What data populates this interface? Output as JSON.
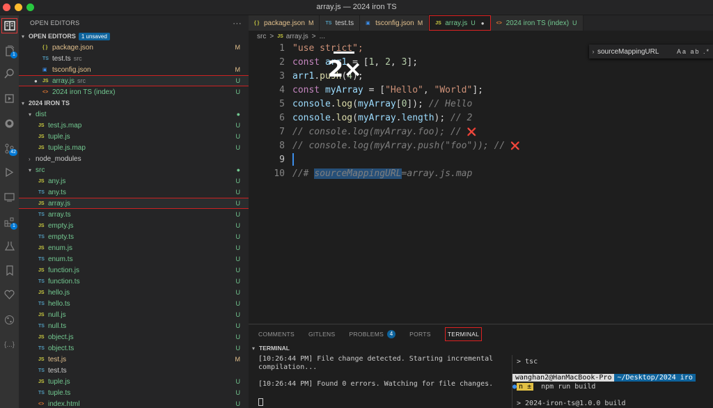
{
  "window": {
    "title": "array.js — 2024 iron TS"
  },
  "activity_bar": {
    "items": [
      {
        "name": "explorer",
        "icon": "explorer-icon",
        "active": true
      },
      {
        "name": "files",
        "icon": "files-icon",
        "badge": "1"
      },
      {
        "name": "search",
        "icon": "search-icon"
      },
      {
        "name": "run",
        "icon": "run-icon"
      },
      {
        "name": "github",
        "icon": "github-icon"
      },
      {
        "name": "source-control",
        "icon": "source-control-icon",
        "badge": "42"
      },
      {
        "name": "debug",
        "icon": "debug-icon"
      },
      {
        "name": "remote",
        "icon": "remote-icon"
      },
      {
        "name": "extensions",
        "icon": "extensions-icon",
        "badge": "1"
      },
      {
        "name": "testing",
        "icon": "flask-icon"
      },
      {
        "name": "bookmarks",
        "icon": "bookmark-icon"
      },
      {
        "name": "favorites",
        "icon": "heart-icon"
      },
      {
        "name": "git-graph",
        "icon": "git-graph-icon"
      },
      {
        "name": "json",
        "icon": "braces-icon"
      }
    ]
  },
  "sidebar": {
    "header": "OPEN EDITORS",
    "open_editors": {
      "title": "OPEN EDITORS",
      "unsaved": "1 unsaved",
      "items": [
        {
          "icon": "{ }",
          "type": "json",
          "name": "package.json",
          "sub": "",
          "status": "M"
        },
        {
          "icon": "TS",
          "type": "ts",
          "name": "test.ts",
          "sub": "src",
          "status": ""
        },
        {
          "icon": "▣",
          "type": "cfg",
          "name": "tsconfig.json",
          "sub": "",
          "status": "M"
        },
        {
          "icon": "JS",
          "type": "js",
          "name": "array.js",
          "sub": "src",
          "status": "U",
          "dirty": true
        },
        {
          "icon": "<>",
          "type": "html",
          "name": "2024 iron TS (index)",
          "sub": "",
          "status": "U"
        }
      ]
    },
    "project": {
      "title": "2024 IRON TS",
      "dist": {
        "name": "dist",
        "files": [
          {
            "icon": "JS",
            "type": "js",
            "name": "test.js.map",
            "status": "U"
          },
          {
            "icon": "JS",
            "type": "js",
            "name": "tuple.js",
            "status": "U"
          },
          {
            "icon": "JS",
            "type": "js",
            "name": "tuple.js.map",
            "status": "U"
          }
        ]
      },
      "node_modules": "node_modules",
      "src": {
        "name": "src",
        "files": [
          {
            "icon": "JS",
            "type": "js",
            "name": "any.js",
            "status": "U"
          },
          {
            "icon": "TS",
            "type": "ts",
            "name": "any.ts",
            "status": "U"
          },
          {
            "icon": "JS",
            "type": "js",
            "name": "array.js",
            "status": "U"
          },
          {
            "icon": "TS",
            "type": "ts",
            "name": "array.ts",
            "status": "U"
          },
          {
            "icon": "JS",
            "type": "js",
            "name": "empty.js",
            "status": "U"
          },
          {
            "icon": "TS",
            "type": "ts",
            "name": "empty.ts",
            "status": "U"
          },
          {
            "icon": "JS",
            "type": "js",
            "name": "enum.js",
            "status": "U"
          },
          {
            "icon": "TS",
            "type": "ts",
            "name": "enum.ts",
            "status": "U"
          },
          {
            "icon": "JS",
            "type": "js",
            "name": "function.js",
            "status": "U"
          },
          {
            "icon": "TS",
            "type": "ts",
            "name": "function.ts",
            "status": "U"
          },
          {
            "icon": "JS",
            "type": "js",
            "name": "hello.js",
            "status": "U"
          },
          {
            "icon": "TS",
            "type": "ts",
            "name": "hello.ts",
            "status": "U"
          },
          {
            "icon": "JS",
            "type": "js",
            "name": "null.js",
            "status": "U"
          },
          {
            "icon": "TS",
            "type": "ts",
            "name": "null.ts",
            "status": "U"
          },
          {
            "icon": "JS",
            "type": "js",
            "name": "object.js",
            "status": "U"
          },
          {
            "icon": "TS",
            "type": "ts",
            "name": "object.ts",
            "status": "U"
          },
          {
            "icon": "JS",
            "type": "js",
            "name": "test.js",
            "status": "M"
          },
          {
            "icon": "TS",
            "type": "ts",
            "name": "test.ts",
            "status": ""
          },
          {
            "icon": "JS",
            "type": "js",
            "name": "tuple.js",
            "status": "U"
          },
          {
            "icon": "TS",
            "type": "ts",
            "name": "tuple.ts",
            "status": "U"
          },
          {
            "icon": "<>",
            "type": "html",
            "name": "index.html",
            "status": "U"
          }
        ]
      }
    }
  },
  "tabs": [
    {
      "icon": "{ }",
      "type": "json",
      "name": "package.json",
      "status": "M"
    },
    {
      "icon": "TS",
      "type": "ts",
      "name": "test.ts",
      "status": ""
    },
    {
      "icon": "▣",
      "type": "cfg",
      "name": "tsconfig.json",
      "status": "M"
    },
    {
      "icon": "JS",
      "type": "js",
      "name": "array.js",
      "status": "U",
      "active": true,
      "dirty": true
    },
    {
      "icon": "<>",
      "type": "html",
      "name": "2024 iron TS (index)",
      "status": "U"
    }
  ],
  "breadcrumb": {
    "folder": "src",
    "sep": ">",
    "file_icon": "JS",
    "file": "array.js",
    "more": "..."
  },
  "editor": {
    "line_numbers": [
      "1",
      "2",
      "3",
      "4",
      "5",
      "6",
      "7",
      "8",
      "9",
      "10"
    ],
    "lines": [
      [
        {
          "t": "\"use strict\";",
          "c": "s"
        }
      ],
      [
        {
          "t": "const ",
          "c": "k"
        },
        {
          "t": "arr1",
          "c": "v"
        },
        {
          "t": " = [",
          "c": "p"
        },
        {
          "t": "1",
          "c": "n"
        },
        {
          "t": ", ",
          "c": "p"
        },
        {
          "t": "2",
          "c": "n"
        },
        {
          "t": ", ",
          "c": "p"
        },
        {
          "t": "3",
          "c": "n"
        },
        {
          "t": "];",
          "c": "p"
        }
      ],
      [
        {
          "t": "arr1",
          "c": "v"
        },
        {
          "t": ".",
          "c": "p"
        },
        {
          "t": "push",
          "c": "f"
        },
        {
          "t": "(",
          "c": "p"
        },
        {
          "t": "4",
          "c": "n"
        },
        {
          "t": ");",
          "c": "p"
        }
      ],
      [
        {
          "t": "const ",
          "c": "k"
        },
        {
          "t": "myArray",
          "c": "v"
        },
        {
          "t": " = [",
          "c": "p"
        },
        {
          "t": "\"Hello\"",
          "c": "s"
        },
        {
          "t": ", ",
          "c": "p"
        },
        {
          "t": "\"World\"",
          "c": "s"
        },
        {
          "t": "];",
          "c": "p"
        }
      ],
      [
        {
          "t": "console",
          "c": "v"
        },
        {
          "t": ".",
          "c": "p"
        },
        {
          "t": "log",
          "c": "f"
        },
        {
          "t": "(",
          "c": "p"
        },
        {
          "t": "myArray",
          "c": "v"
        },
        {
          "t": "[",
          "c": "p"
        },
        {
          "t": "0",
          "c": "n"
        },
        {
          "t": "]); ",
          "c": "p"
        },
        {
          "t": "// Hello",
          "c": "cg"
        }
      ],
      [
        {
          "t": "console",
          "c": "v"
        },
        {
          "t": ".",
          "c": "p"
        },
        {
          "t": "log",
          "c": "f"
        },
        {
          "t": "(",
          "c": "p"
        },
        {
          "t": "myArray",
          "c": "v"
        },
        {
          "t": ".",
          "c": "p"
        },
        {
          "t": "length",
          "c": "v"
        },
        {
          "t": "); ",
          "c": "p"
        },
        {
          "t": "// 2",
          "c": "cg"
        }
      ],
      [
        {
          "t": "// console.log(myArray.foo); // ",
          "c": "cg"
        },
        {
          "t": "❌",
          "c": "x"
        }
      ],
      [
        {
          "t": "// console.log(myArray.push(\"foo\")); // ",
          "c": "cg"
        },
        {
          "t": "❌",
          "c": "x"
        }
      ],
      [
        {
          "t": "",
          "c": "p"
        }
      ],
      [
        {
          "t": "//# ",
          "c": "cg"
        },
        {
          "t": "sourceMappingURL",
          "c": "cgm"
        },
        {
          "t": "=array.js.map",
          "c": "cg"
        }
      ]
    ]
  },
  "find_widget": {
    "query": "sourceMappingURL",
    "options": "Aa ab .*"
  },
  "zoom_overlay": {
    "label": "2×"
  },
  "panel": {
    "tabs": [
      {
        "label": "COMMENTS"
      },
      {
        "label": "GITLENS"
      },
      {
        "label": "PROBLEMS",
        "badge": "4"
      },
      {
        "label": "PORTS"
      },
      {
        "label": "TERMINAL",
        "active": true
      }
    ],
    "section": "TERMINAL",
    "terminal_left": {
      "line1": "[10:26:44 PM] File change detected. Starting incremental compilation...",
      "line2": "[10:26:44 PM] Found 0 errors. Watching for file changes."
    },
    "terminal_right": {
      "cmd_prev": "> tsc",
      "prompt_user": "wanghan2@HanMacBook-Pro",
      "prompt_path": "~/Desktop/2024 iro",
      "prompt_git": "n ±",
      "cmd": "npm run build",
      "output": "> 2024-iron-ts@1.0.0 build"
    }
  }
}
